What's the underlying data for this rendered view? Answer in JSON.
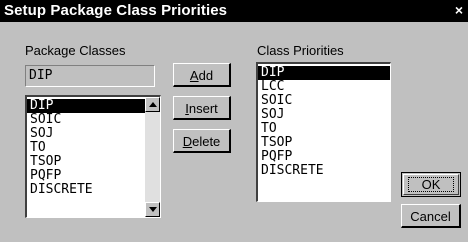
{
  "window": {
    "title": "Setup Package Class Priorities",
    "close_glyph": "×"
  },
  "package_classes": {
    "label": "Package Classes",
    "current_value": "DIP",
    "items": [
      "DIP",
      "SOIC",
      "SOJ",
      "TO",
      "TSOP",
      "PQFP",
      "DISCRETE"
    ],
    "selected_index": 0
  },
  "class_priorities": {
    "label": "Class Priorities",
    "items": [
      "DIP",
      "LCC",
      "SOIC",
      "SOJ",
      "TO",
      "TSOP",
      "PQFP",
      "DISCRETE"
    ],
    "selected_index": 0
  },
  "buttons": {
    "add": {
      "accel": "A",
      "rest": "dd"
    },
    "insert": {
      "accel": "I",
      "rest": "nsert"
    },
    "delete": {
      "accel": "D",
      "rest": "elete"
    },
    "ok": "OK",
    "cancel": "Cancel"
  },
  "icons": {
    "scroll_up": "triangle-up-icon",
    "scroll_down": "triangle-down-icon",
    "close": "close-icon"
  },
  "colors": {
    "face": "#c0c0c0",
    "titlebar": "#000000",
    "selection": "#000000"
  }
}
